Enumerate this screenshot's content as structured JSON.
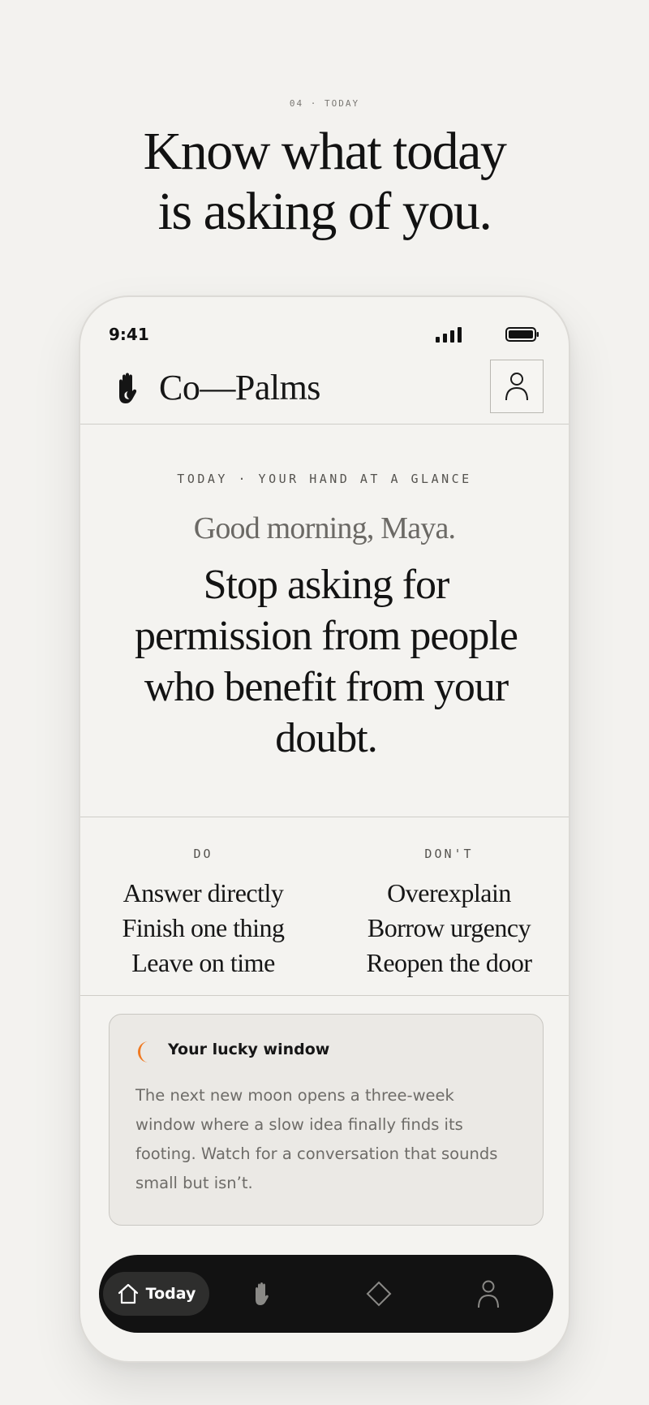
{
  "marketing": {
    "eyebrow": "04 · TODAY",
    "headline_line1": "Know what today",
    "headline_line2": "is asking of you."
  },
  "status_bar": {
    "time": "9:41"
  },
  "app": {
    "name": "Co—Palms",
    "icons": {
      "logo": "hand-palm-icon",
      "profile": "person-icon"
    }
  },
  "hero": {
    "eyebrow": "TODAY · YOUR HAND AT A GLANCE",
    "greeting": "Good morning, Maya.",
    "message": "Stop asking for permission from people who benefit from your doubt."
  },
  "guidance": {
    "do_title": "DO",
    "do_items": [
      "Answer directly",
      "Finish one thing",
      "Leave on time"
    ],
    "dont_title": "DON'T",
    "dont_items": [
      "Overexplain",
      "Borrow urgency",
      "Reopen the door"
    ]
  },
  "lucky_window": {
    "icon": "crescent-moon-icon",
    "title": "Your lucky window",
    "body": "The next new moon opens a three-week window where a slow idea finally finds its footing. Watch for a conversation that sounds small but isn’t."
  },
  "tab_bar": {
    "tabs": [
      {
        "label": "Today",
        "icon": "home-icon",
        "active": true
      },
      {
        "label": "",
        "icon": "palm-icon",
        "active": false
      },
      {
        "label": "",
        "icon": "diamond-icon",
        "active": false
      },
      {
        "label": "",
        "icon": "person-icon",
        "active": false
      }
    ]
  },
  "colors": {
    "background": "#f3f2ef",
    "ink": "#141414",
    "accent_moon": "#f07a22",
    "tab_bar": "#121212"
  }
}
